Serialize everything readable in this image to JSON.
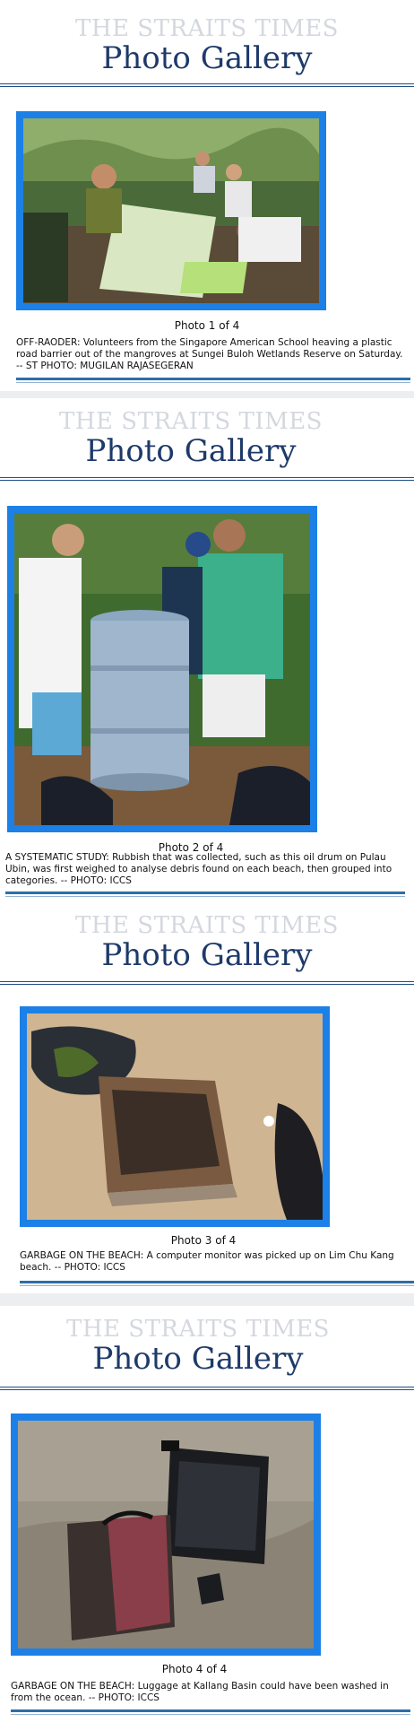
{
  "masthead": {
    "brand": "THE STRAITS TIMES",
    "title": "Photo Gallery"
  },
  "photos": [
    {
      "counter": "Photo 1 of 4",
      "caption": "OFF-RAODER: Volunteers from the Singapore American School heaving a plastic road barrier out of the mangroves at Sungei Buloh Wetlands Reserve on Saturday. -- ST PHOTO: MUGILAN RAJASEGERAN"
    },
    {
      "counter": "Photo 2 of 4",
      "caption": "A SYSTEMATIC STUDY: Rubbish that was collected, such as this oil drum on Pulau Ubin, was first weighed to analyse debris found on each beach, then grouped into categories. -- PHOTO: ICCS"
    },
    {
      "counter": "Photo 3 of 4",
      "caption": "GARBAGE ON THE BEACH: A computer monitor was picked up on Lim Chu Kang beach. -- PHOTO: ICCS"
    },
    {
      "counter": "Photo 4 of 4",
      "caption": "GARBAGE ON THE BEACH: Luggage at Kallang Basin could have been washed in from the ocean. -- PHOTO: ICCS"
    }
  ],
  "colors": {
    "frame": "#1c80e6",
    "title": "#1e3a6a",
    "brand": "#d4d8de"
  }
}
